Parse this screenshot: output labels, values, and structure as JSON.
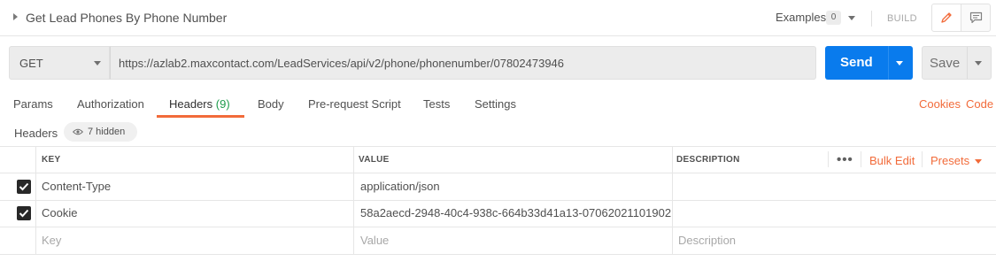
{
  "request": {
    "name": "Get Lead Phones By Phone Number"
  },
  "topbar": {
    "examples_label": "Examples",
    "examples_count": "0",
    "build_label": "BUILD"
  },
  "url_bar": {
    "method": "GET",
    "url": "https://azlab2.maxcontact.com/LeadServices/api/v2/phone/phonenumber/07802473946",
    "send_label": "Send",
    "save_label": "Save"
  },
  "tabs": [
    {
      "label": "Params"
    },
    {
      "label": "Authorization"
    },
    {
      "label": "Headers",
      "count": "(9)",
      "active": true
    },
    {
      "label": "Body"
    },
    {
      "label": "Pre-request Script"
    },
    {
      "label": "Tests"
    },
    {
      "label": "Settings"
    }
  ],
  "tab_links": {
    "cookies": "Cookies",
    "code": "Code"
  },
  "headers_section": {
    "label": "Headers",
    "hidden_label": "7 hidden"
  },
  "table": {
    "columns": {
      "key": "KEY",
      "value": "VALUE",
      "description": "DESCRIPTION"
    },
    "more_label": "•••",
    "bulk_edit_label": "Bulk Edit",
    "presets_label": "Presets",
    "rows": [
      {
        "checked": true,
        "key": "Content-Type",
        "value": "application/json",
        "description": ""
      },
      {
        "checked": true,
        "key": "Cookie",
        "value": "58a2aecd-2948-40c4-938c-664b33d41a13-07062021101902",
        "description": ""
      }
    ],
    "placeholders": {
      "key": "Key",
      "value": "Value",
      "description": "Description"
    }
  },
  "colors": {
    "accent": "#f26b3a",
    "send_blue": "#097bed",
    "count_green": "#1d9c4b"
  }
}
